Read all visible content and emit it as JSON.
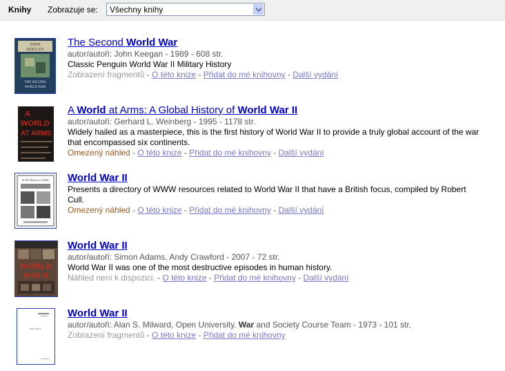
{
  "header": {
    "section_label": "Knihy",
    "showing_label": "Zobrazuje se:",
    "filter_value": "Všechny knihy"
  },
  "results": [
    {
      "title_parts": [
        {
          "t": "The Second ",
          "b": false
        },
        {
          "t": "World War",
          "b": true
        }
      ],
      "meta": "autor/autoři: John Keegan - 1989 - 608 str.",
      "desc": "Classic Penguin World War II Military History",
      "preview": "Zobrazení fragmentů",
      "preview_type": "snippet",
      "links": [
        "O této knize",
        "Přidat do mé knihovny",
        "Další vydání"
      ],
      "cover_text": [
        "JOHN",
        "KEEGAN",
        "THE SECOND",
        "WORLD WAR"
      ]
    },
    {
      "title_parts": [
        {
          "t": "A ",
          "b": false
        },
        {
          "t": "World",
          "b": true
        },
        {
          "t": " at Arms: A Global History of ",
          "b": false
        },
        {
          "t": "World War II",
          "b": true
        }
      ],
      "meta": "autor/autoři: Gerhard L. Weinberg - 1995 - 1178 str.",
      "desc": "Widely hailed as a masterpiece, this is the first history of World War II to provide a truly global account of the war that encompassed six continents.",
      "preview": "Omezený náhled",
      "preview_type": "limited",
      "links": [
        "O této knize",
        "Přidat do mé knihovny",
        "Další vydání"
      ],
      "cover_text": [
        "A",
        "WORLD",
        "AT ARMS"
      ]
    },
    {
      "title_parts": [
        {
          "t": "World War II",
          "b": true
        }
      ],
      "meta": "",
      "desc": "Presents a directory of WWW resources related to World War II that have a British focus, compiled by Robert Cull.",
      "preview": "Omezený náhled",
      "preview_type": "limited",
      "links": [
        "O této knize",
        "Přidat do mé knihovny",
        "Další vydání"
      ],
      "cover_text": [
        "In The Words of a Child"
      ]
    },
    {
      "title_parts": [
        {
          "t": "World War II",
          "b": true
        }
      ],
      "meta": "autor/autoři: Simon Adams, Andy Crawford - 2007 - 72 str.",
      "desc": "World War II was one of the most destructive episodes in human history.",
      "preview": "Náhled není k dispozici.",
      "preview_type": "none",
      "links": [
        "O této knize",
        "Přidat do mé knihovny",
        "Další vydání"
      ],
      "cover_text": [
        "WORLD",
        "WAR II"
      ]
    },
    {
      "title_parts": [
        {
          "t": "World War II",
          "b": true
        }
      ],
      "meta_parts": [
        {
          "t": "autor/autoři: Alan S. Milward, Open University. ",
          "b": false
        },
        {
          "t": "War",
          "b": true
        },
        {
          "t": " and Society Course Team - 1973 - 101 str.",
          "b": false
        }
      ],
      "meta": "",
      "desc": "",
      "preview": "Zobrazení fragmentů",
      "preview_type": "snippet",
      "links": [
        "O této knize",
        "Přidat do mé knihovny"
      ],
      "cover_text": [
        "World War II"
      ]
    }
  ]
}
